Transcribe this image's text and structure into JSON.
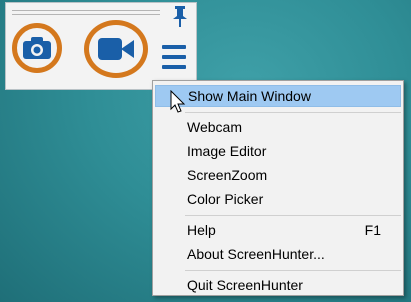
{
  "widget": {
    "buttons": [
      {
        "icon": "camera-icon",
        "tooltip": ""
      },
      {
        "icon": "video-camera-icon",
        "tooltip": ""
      }
    ],
    "ring_color": "#d4781d",
    "icon_color": "#1a5fa8"
  },
  "menu": {
    "items": [
      {
        "label": "Show Main Window",
        "shortcut": "",
        "highlighted": true
      },
      {
        "label": "Webcam",
        "shortcut": ""
      },
      {
        "label": "Image Editor",
        "shortcut": ""
      },
      {
        "label": "ScreenZoom",
        "shortcut": ""
      },
      {
        "label": "Color Picker",
        "shortcut": ""
      },
      {
        "label": "Help",
        "shortcut": "F1"
      },
      {
        "label": "About ScreenHunter...",
        "shortcut": ""
      },
      {
        "label": "Quit ScreenHunter",
        "shortcut": ""
      }
    ],
    "highlight_color": "#9ec9f2"
  }
}
